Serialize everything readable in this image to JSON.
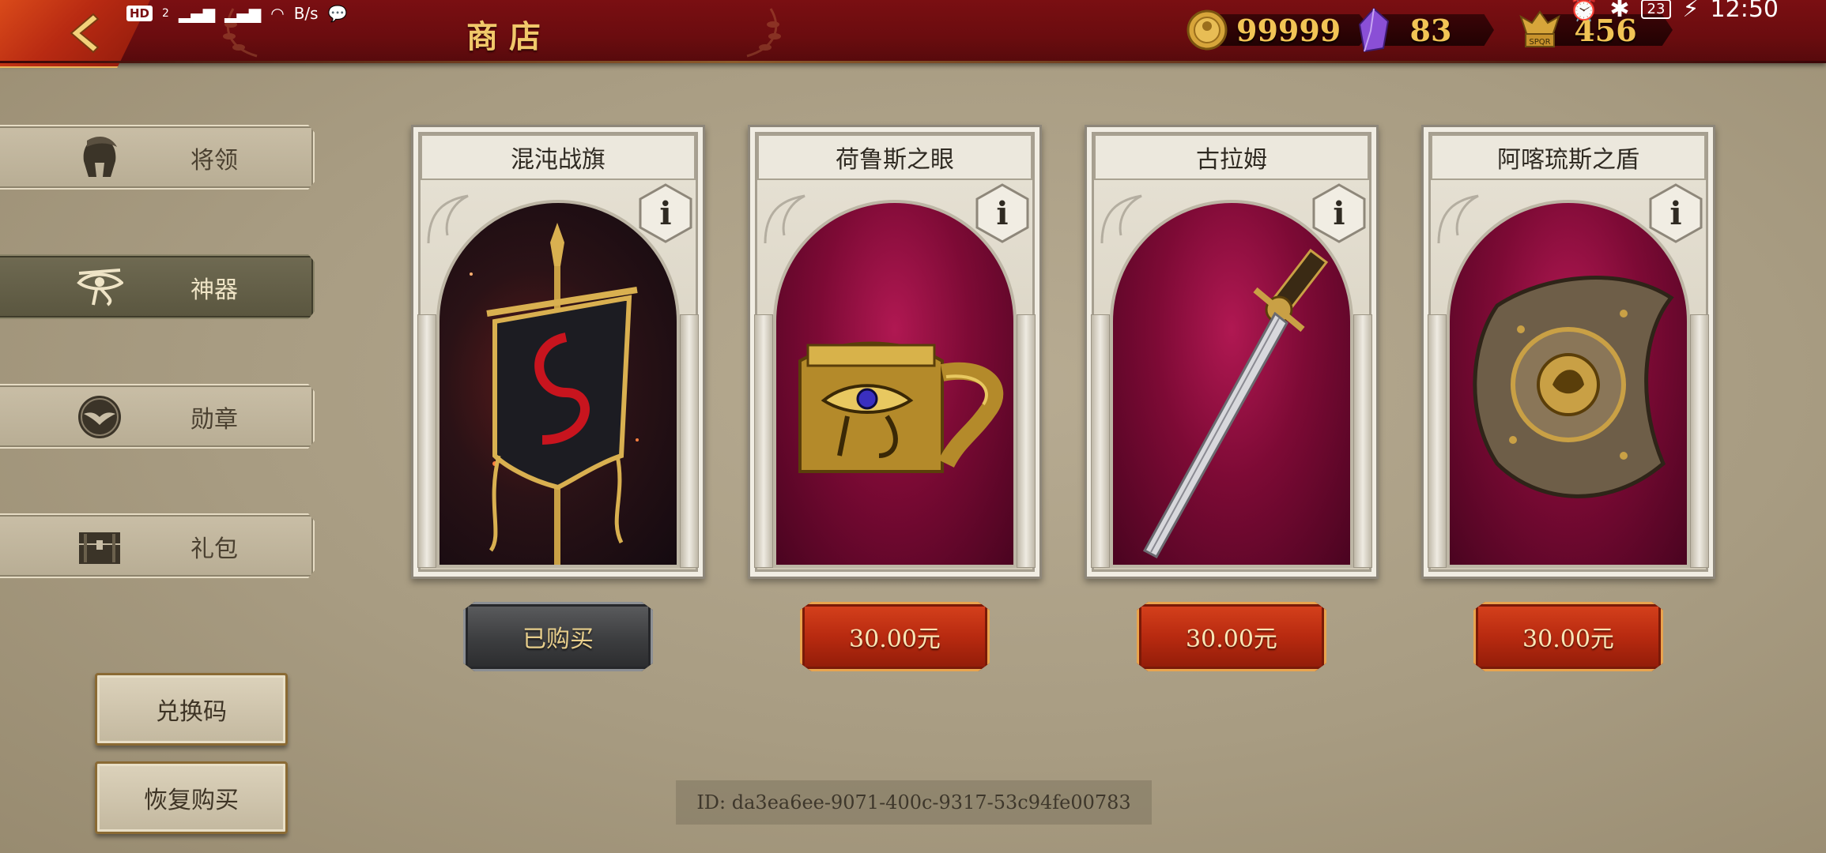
{
  "header": {
    "title": "商店",
    "status": {
      "hd_badge": "HD",
      "sim": "2",
      "net_speed": "B/s",
      "battery": "23",
      "time": "12:50"
    },
    "currencies": [
      {
        "name": "gold-coin",
        "value": "99999"
      },
      {
        "name": "crystal",
        "value": "83"
      },
      {
        "name": "spqr-token",
        "value": "456"
      }
    ]
  },
  "sidebar": {
    "tabs": [
      {
        "label": "将领",
        "icon": "spartan-helmet-icon",
        "active": false
      },
      {
        "label": "神器",
        "icon": "eye-of-horus-icon",
        "active": true
      },
      {
        "label": "勋章",
        "icon": "eagle-medal-icon",
        "active": false
      },
      {
        "label": "礼包",
        "icon": "treasure-chest-icon",
        "active": false
      }
    ],
    "redeem_label": "兑换码",
    "restore_label": "恢复购买"
  },
  "items": [
    {
      "name": "混沌战旗",
      "button": "已购买",
      "state": "bought"
    },
    {
      "name": "荷鲁斯之眼",
      "button": "30.00元",
      "state": "price"
    },
    {
      "name": "古拉姆",
      "button": "30.00元",
      "state": "price"
    },
    {
      "name": "阿喀琉斯之盾",
      "button": "30.00元",
      "state": "price"
    }
  ],
  "info_label": "i",
  "user_id": "ID: da3ea6ee-9071-400c-9317-53c94fe00783",
  "colors": {
    "topbar": "#6a0c0f",
    "gold_text": "#f1c86a",
    "price_button": "#b82a10",
    "bought_button": "#3c3d3f",
    "background": "#a89c82"
  }
}
